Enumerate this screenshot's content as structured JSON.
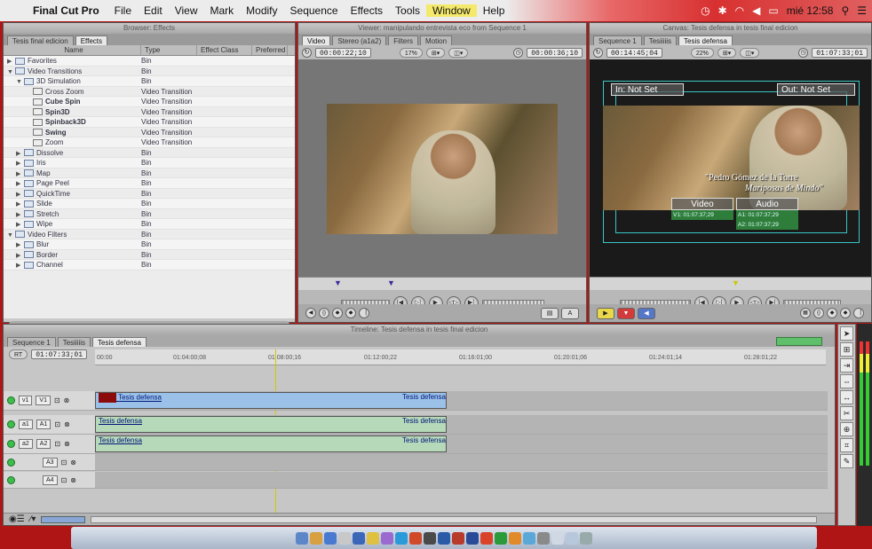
{
  "menubar": {
    "app": "Final Cut Pro",
    "items": [
      "File",
      "Edit",
      "View",
      "Mark",
      "Modify",
      "Sequence",
      "Effects",
      "Tools",
      "Window",
      "Help"
    ],
    "clock": "mié 12:58"
  },
  "browser": {
    "title": "Browser: Effects",
    "tabs": [
      "Tesis final edicion",
      "Effects"
    ],
    "columns": [
      "Name",
      "Type",
      "Effect Class",
      "Preferred"
    ],
    "rows": [
      {
        "indent": 0,
        "tri": "▶",
        "name": "Favorites",
        "type": "Bin",
        "bold": false
      },
      {
        "indent": 0,
        "tri": "▼",
        "name": "Video Transitions",
        "type": "Bin",
        "bold": false
      },
      {
        "indent": 1,
        "tri": "▼",
        "name": "3D Simulation",
        "type": "Bin",
        "bold": false
      },
      {
        "indent": 2,
        "tri": "",
        "name": "Cross Zoom",
        "type": "Video Transition",
        "bold": false
      },
      {
        "indent": 2,
        "tri": "",
        "name": "Cube Spin",
        "type": "Video Transition",
        "bold": true
      },
      {
        "indent": 2,
        "tri": "",
        "name": "Spin3D",
        "type": "Video Transition",
        "bold": true
      },
      {
        "indent": 2,
        "tri": "",
        "name": "Spinback3D",
        "type": "Video Transition",
        "bold": true
      },
      {
        "indent": 2,
        "tri": "",
        "name": "Swing",
        "type": "Video Transition",
        "bold": true
      },
      {
        "indent": 2,
        "tri": "",
        "name": "Zoom",
        "type": "Video Transition",
        "bold": false
      },
      {
        "indent": 1,
        "tri": "▶",
        "name": "Dissolve",
        "type": "Bin",
        "bold": false
      },
      {
        "indent": 1,
        "tri": "▶",
        "name": "Iris",
        "type": "Bin",
        "bold": false
      },
      {
        "indent": 1,
        "tri": "▶",
        "name": "Map",
        "type": "Bin",
        "bold": false
      },
      {
        "indent": 1,
        "tri": "▶",
        "name": "Page Peel",
        "type": "Bin",
        "bold": false
      },
      {
        "indent": 1,
        "tri": "▶",
        "name": "QuickTime",
        "type": "Bin",
        "bold": false
      },
      {
        "indent": 1,
        "tri": "▶",
        "name": "Slide",
        "type": "Bin",
        "bold": false
      },
      {
        "indent": 1,
        "tri": "▶",
        "name": "Stretch",
        "type": "Bin",
        "bold": false
      },
      {
        "indent": 1,
        "tri": "▶",
        "name": "Wipe",
        "type": "Bin",
        "bold": false
      },
      {
        "indent": 0,
        "tri": "▼",
        "name": "Video Filters",
        "type": "Bin",
        "bold": false
      },
      {
        "indent": 1,
        "tri": "▶",
        "name": "Blur",
        "type": "Bin",
        "bold": false
      },
      {
        "indent": 1,
        "tri": "▶",
        "name": "Border",
        "type": "Bin",
        "bold": false
      },
      {
        "indent": 1,
        "tri": "▶",
        "name": "Channel",
        "type": "Bin",
        "bold": false
      }
    ]
  },
  "viewer": {
    "title": "Viewer: manipulando entrevista eco from Sequence 1",
    "tabs": [
      "Video",
      "Stereo (a1a2)",
      "Filters",
      "Motion"
    ],
    "timecode_left": "00:00:22;10",
    "zoom": "17%",
    "timecode_right": "00:00:36;10"
  },
  "canvas": {
    "title": "Canvas: Tesis defensa in tesis final edicion",
    "tabs": [
      "Sequence 1",
      "Tesiiiiis",
      "Tesis defensa"
    ],
    "timecode_left": "00:14:45;04",
    "zoom": "22%",
    "timecode_right": "01:07:33;01",
    "in_label": "In: Not Set",
    "out_label": "Out: Not Set",
    "caption_line1": "\"Pedro Gómez de la Torre",
    "caption_line2": "Mariposas de Mindo\"",
    "video_label": "Video",
    "audio_label": "Audio",
    "v1_tc": "V1: 01:07:37;29",
    "a1_tc": "A1: 01:07:37;29",
    "a2_tc": "A2: 01:07:37;29"
  },
  "timeline": {
    "title": "Timeline: Tesis defensa in tesis final edicion",
    "tabs": [
      "Sequence 1",
      "Tesiiiiis",
      "Tesis defensa"
    ],
    "rt": "RT",
    "current_tc": "01:07:33;01",
    "ruler": [
      "00:00",
      "01:04:00;08",
      "01:08:00;16",
      "01:12:00;22",
      "01:16:01;00",
      "01:20:01;06",
      "01:24:01;14",
      "01:28:01;22"
    ],
    "clip_name": "Tesis defensa",
    "tracks": {
      "v1": [
        "v1",
        "V1"
      ],
      "a1": [
        "a1",
        "A1"
      ],
      "a2": [
        "a2",
        "A2"
      ],
      "a3": "A3",
      "a4": "A4"
    }
  }
}
